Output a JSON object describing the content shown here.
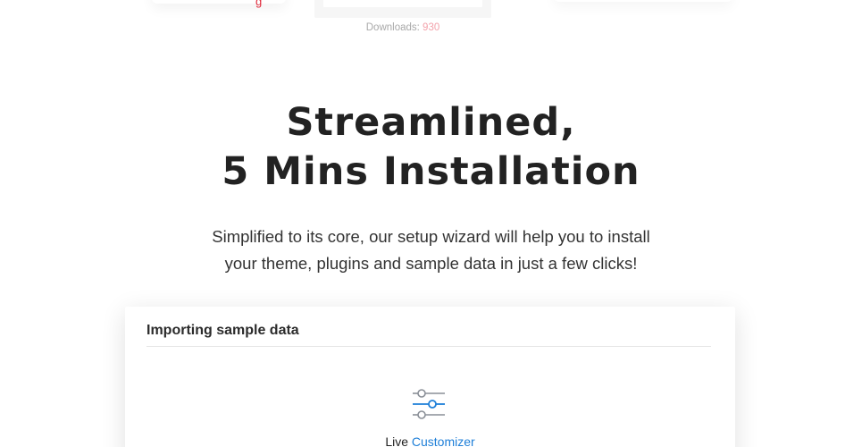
{
  "top": {
    "left_fragment_text": "g",
    "downloads_label": "Downloads:",
    "downloads_count": "930"
  },
  "headline": {
    "line1": "Streamlined,",
    "line2": "5 Mins Installation"
  },
  "subtext": {
    "line1": "Simplified to its core, our setup wizard will help you to install",
    "line2": "your theme, plugins and sample data in just a few clicks!"
  },
  "panel": {
    "title": "Importing sample data",
    "icon": "sliders-icon",
    "caption_prefix": "Live",
    "caption_accent": "Customizer"
  },
  "colors": {
    "accent_blue": "#1e7fd8",
    "accent_red": "#e02b3c",
    "downloads_count": "#f3a2ab",
    "heading": "#222222"
  }
}
